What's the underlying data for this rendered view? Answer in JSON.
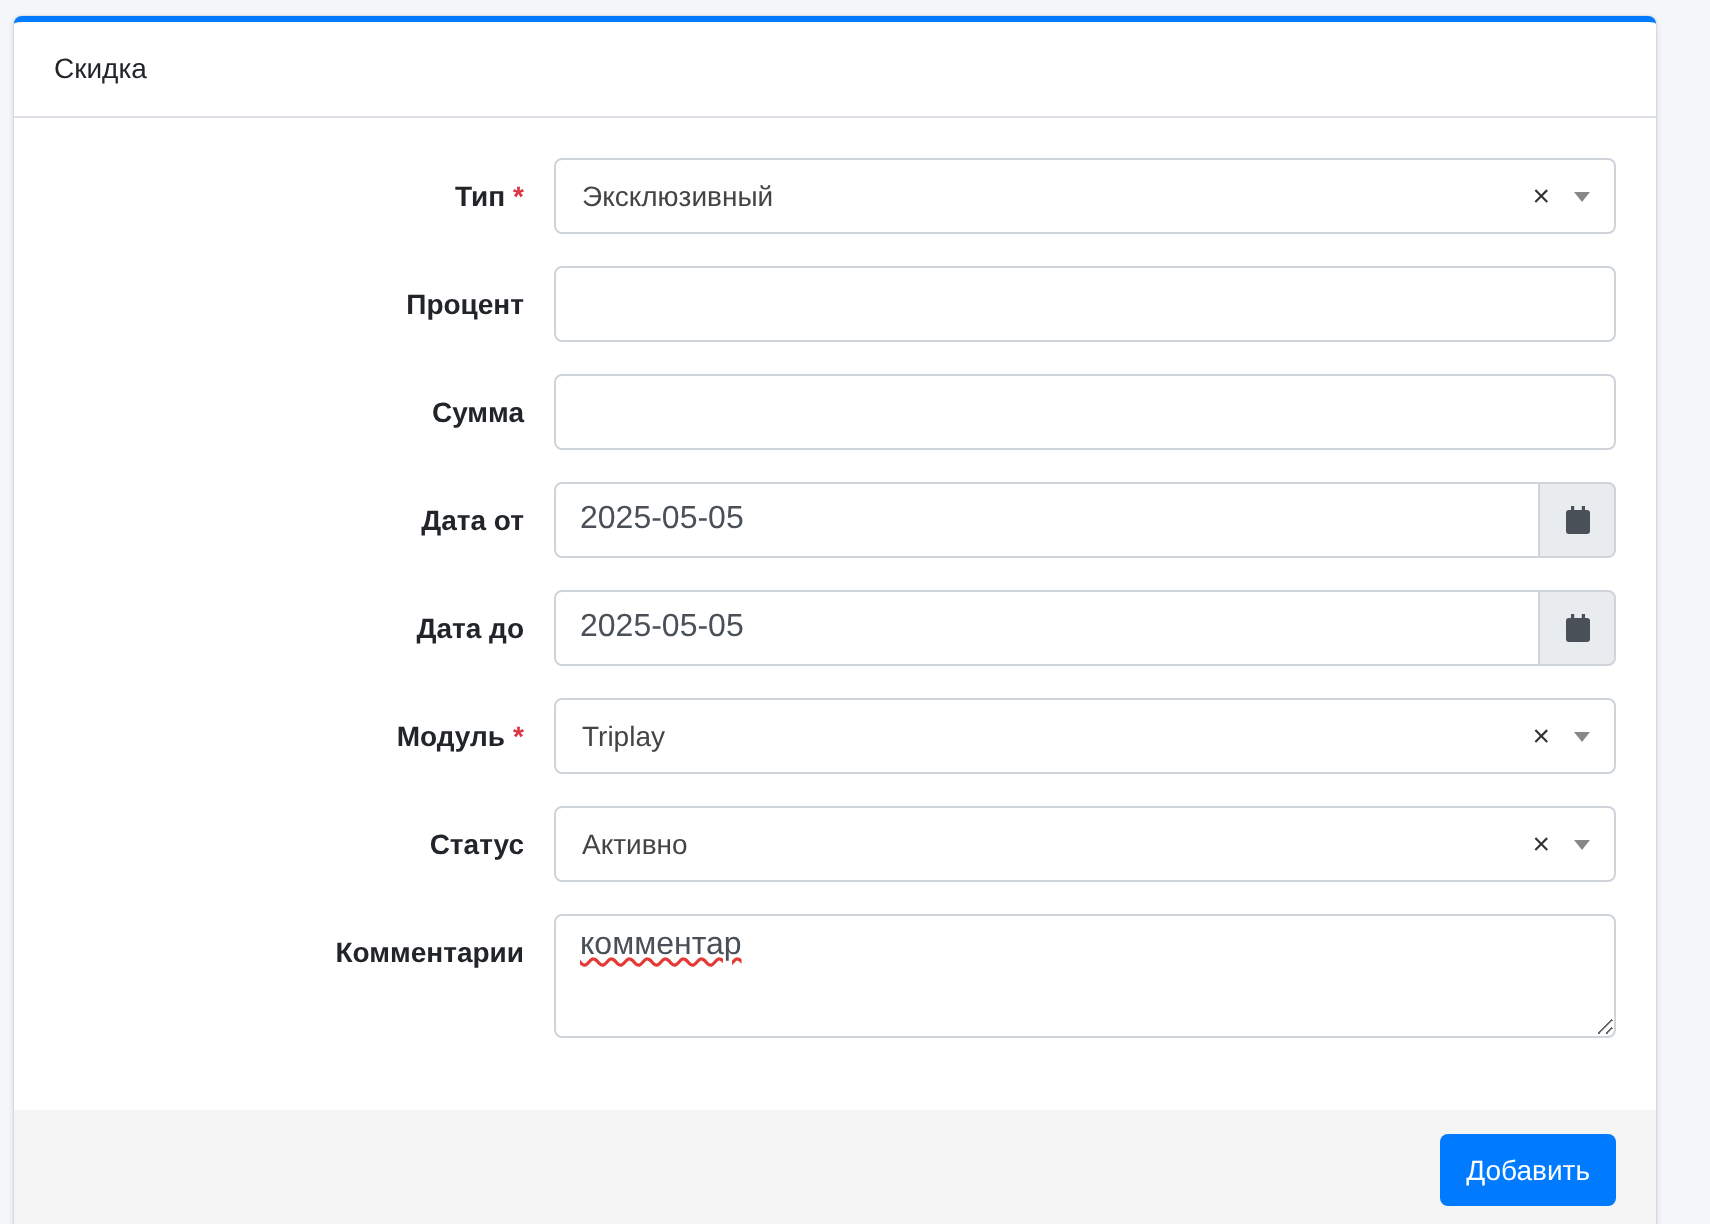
{
  "card": {
    "title": "Скидка"
  },
  "fields": [
    {
      "kind": "select",
      "label": "Тип",
      "required_mark": "*",
      "value": "Эксклюзивный",
      "clear": "×"
    },
    {
      "kind": "text",
      "label": "Процент"
    },
    {
      "kind": "text",
      "label": "Сумма"
    },
    {
      "kind": "date",
      "label": "Дата от",
      "value": "2025-05-05"
    },
    {
      "kind": "date",
      "label": "Дата до",
      "value": "2025-05-05"
    },
    {
      "kind": "select",
      "label": "Модуль",
      "required_mark": "*",
      "value": "Triplay",
      "clear": "×"
    },
    {
      "kind": "select",
      "label": "Статус",
      "value": "Активно",
      "clear": "×"
    },
    {
      "kind": "textarea",
      "label": "Комментарии",
      "value": "комментар",
      "misspelled": true
    }
  ],
  "footer": {
    "button": "Добавить"
  }
}
